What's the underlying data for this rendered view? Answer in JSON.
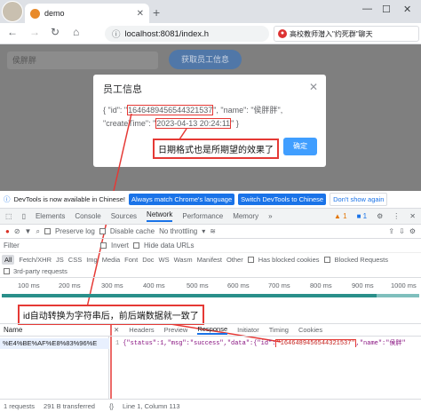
{
  "browser": {
    "tab_title": "demo",
    "url": "localhost:8081/index.h",
    "news_text": "高校教师潜入\"约死群\"聊天"
  },
  "page": {
    "input_value": "侯胖胖",
    "fetch_button": "获取员工信息"
  },
  "dialog": {
    "title": "员工信息",
    "json_prefix": "{ \"id\": \"",
    "id_value": "1646489456544321537",
    "json_middle": "\", \"name\": \"侯胖胖\",",
    "json_line2_prefix": "\"createTime\": \"",
    "create_time": "2023-04-13 20:24:11",
    "json_end": "\" }",
    "ok_button": "确定"
  },
  "annotations": {
    "date_note": "日期格式也是所期望的效果了",
    "id_note": "id自动转换为字符串后，前后端数据就一致了"
  },
  "devtools": {
    "info_text": "DevTools is now available in Chinese!",
    "btn_match": "Always match Chrome's language",
    "btn_switch": "Switch DevTools to Chinese",
    "btn_dont": "Don't show again",
    "tabs": [
      "Elements",
      "Console",
      "Sources",
      "Network",
      "Performance",
      "Memory"
    ],
    "active_tab": "Network",
    "warn_count": "1",
    "msg_count": "1",
    "preserve_log": "Preserve log",
    "disable_cache": "Disable cache",
    "throttle": "No throttling",
    "filter_placeholder": "Filter",
    "invert": "Invert",
    "hide_data_urls": "Hide data URLs",
    "types": [
      "All",
      "Fetch/XHR",
      "JS",
      "CSS",
      "Img",
      "Media",
      "Font",
      "Doc",
      "WS",
      "Wasm",
      "Manifest",
      "Other"
    ],
    "has_blocked_cookies": "Has blocked cookies",
    "blocked_requests": "Blocked Requests",
    "third_party": "3rd-party requests",
    "ticks": [
      "100 ms",
      "200 ms",
      "300 ms",
      "400 ms",
      "500 ms",
      "600 ms",
      "700 ms",
      "800 ms",
      "900 ms",
      "1000 ms"
    ],
    "col_name": "Name",
    "request_name": "%E4%BE%AF%E8%83%96%E",
    "resp_tabs": [
      "Headers",
      "Preview",
      "Response",
      "Initiator",
      "Timing",
      "Cookies"
    ],
    "active_resp_tab": "Response",
    "resp_line_no": "1",
    "resp_prefix": "{\"status\":1,\"msg\":\"success\",\"data\":{\"id\":",
    "resp_id": "\"1646489456544321537\"",
    "resp_suffix": ",\"name\":\"侯胖\"",
    "requests": "1 requests",
    "transferred": "291 B transferred",
    "position": "Line 1, Column 113"
  }
}
